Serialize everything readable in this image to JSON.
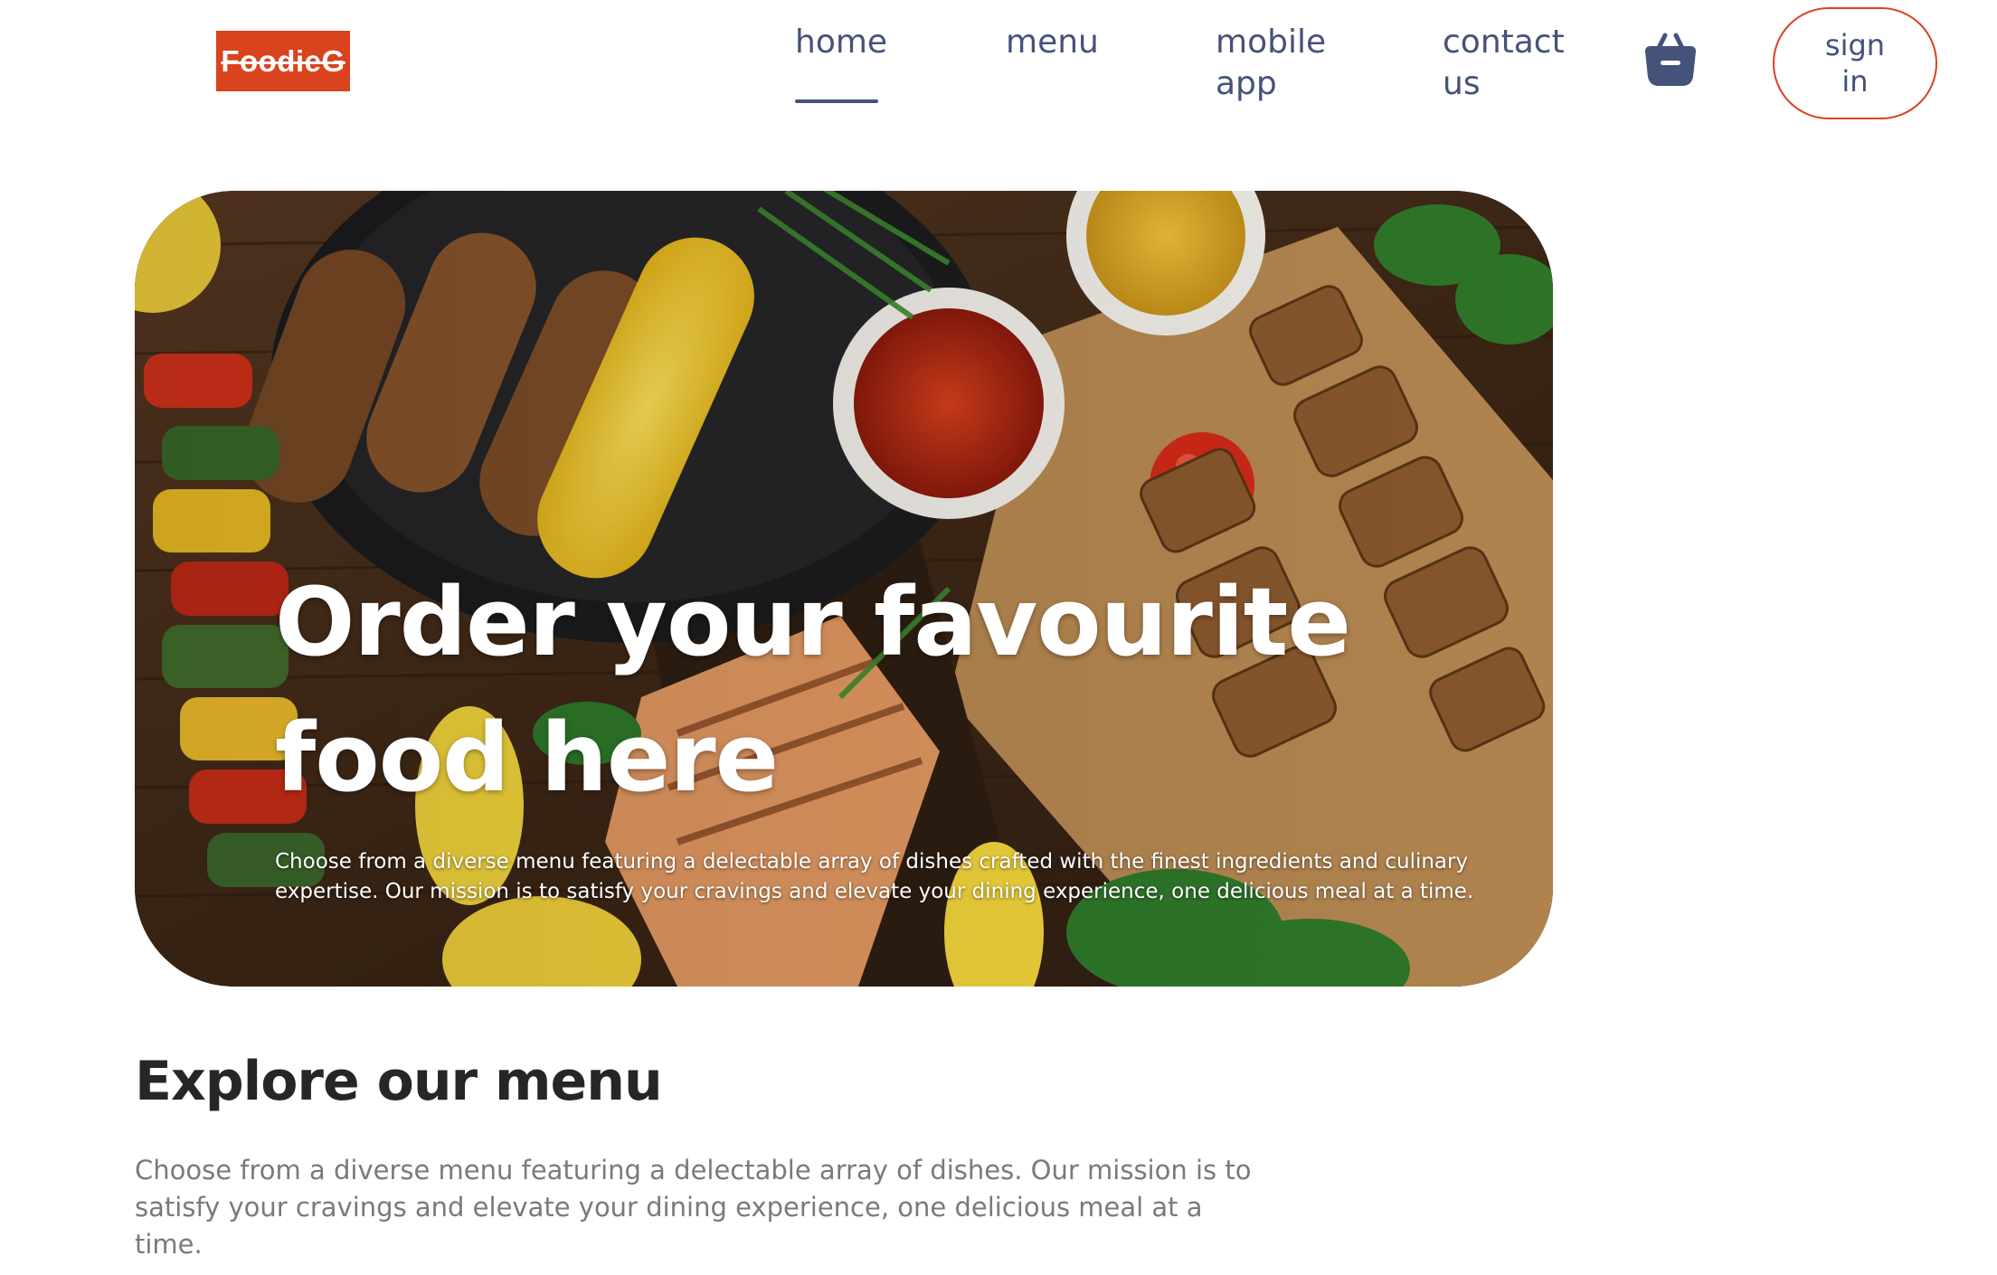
{
  "logo": {
    "text": "FoodieG"
  },
  "nav": {
    "items": [
      {
        "label": "home",
        "active": true
      },
      {
        "label": "menu",
        "active": false
      },
      {
        "label": "mobile app",
        "active": false
      },
      {
        "label": "contact us",
        "active": false
      }
    ]
  },
  "header": {
    "cart_icon": "basket-icon",
    "signin_label": "sign in"
  },
  "hero": {
    "title": "Order your favourite food here",
    "text": "Choose from a diverse menu featuring a delectable array of dishes crafted with the finest ingredients and culinary expertise. Our mission is to satisfy your cravings and elevate your dining experience, one delicious meal at a time."
  },
  "explore": {
    "title": "Explore our menu",
    "text": "Choose from a diverse menu featuring a delectable array of dishes. Our mission is to satisfy your cravings and elevate your dining experience, one delicious meal at a time."
  },
  "colors": {
    "accent": "#d9431e",
    "nav_text": "#45527a",
    "heading": "#262626",
    "body_text": "#7a7a7a"
  }
}
